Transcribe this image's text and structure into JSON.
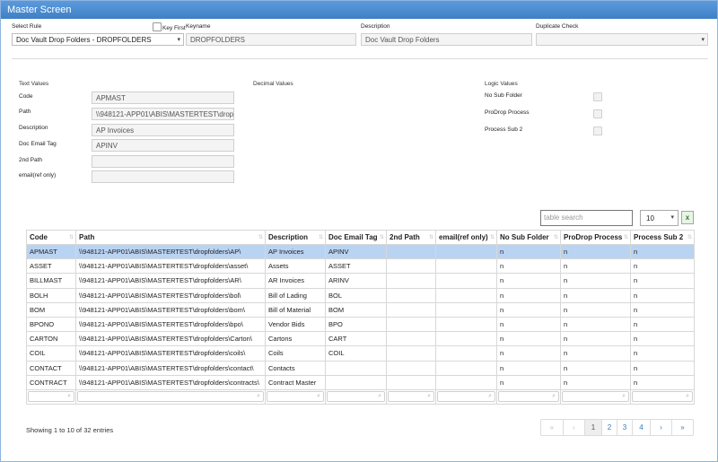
{
  "title": "Master Screen",
  "header": {
    "select_rule_label": "Select Rule",
    "select_rule_value": "Doc Vault Drop Folders - DROPFOLDERS",
    "key_first_label": "Key First",
    "keyname_label": "Keyname",
    "keyname_value": "DROPFOLDERS",
    "description_label": "Description",
    "description_value": "Doc Vault Drop Folders",
    "duplicate_check_label": "Duplicate Check",
    "duplicate_check_value": ""
  },
  "sections": {
    "text_values": "Text Values",
    "decimal_values": "Decimal Values",
    "logic_values": "Logic Values"
  },
  "text_fields": [
    {
      "label": "Code",
      "value": "APMAST"
    },
    {
      "label": "Path",
      "value": "\\\\948121-APP01\\ABIS\\MASTERTEST\\dropfolders\\AP\\"
    },
    {
      "label": "Description",
      "value": "AP Invoices"
    },
    {
      "label": "Doc Email Tag",
      "value": "APINV"
    },
    {
      "label": "2nd Path",
      "value": ""
    },
    {
      "label": "email(ref only)",
      "value": ""
    }
  ],
  "logic_fields": [
    {
      "label": "No Sub Folder",
      "checked": false
    },
    {
      "label": "ProDrop Process",
      "checked": false
    },
    {
      "label": "Process Sub 2",
      "checked": false
    }
  ],
  "table_controls": {
    "search_placeholder": "table search",
    "page_size": "10",
    "excel_icon": "excel-export-icon"
  },
  "table": {
    "columns": [
      "Code",
      "Path",
      "Description",
      "Doc Email Tag",
      "2nd Path",
      "email(ref only)",
      "No Sub Folder",
      "ProDrop Process",
      "Process Sub 2"
    ],
    "rows": [
      [
        "APMAST",
        "\\\\948121-APP01\\ABIS\\MASTERTEST\\dropfolders\\AP\\",
        "AP Invoices",
        "APINV",
        "",
        "",
        "n",
        "n",
        "n"
      ],
      [
        "ASSET",
        "\\\\948121-APP01\\ABIS\\MASTERTEST\\dropfolders\\asset\\",
        "Assets",
        "ASSET",
        "",
        "",
        "n",
        "n",
        "n"
      ],
      [
        "BILLMAST",
        "\\\\948121-APP01\\ABIS\\MASTERTEST\\dropfolders\\AR\\",
        "AR Invoices",
        "ARINV",
        "",
        "",
        "n",
        "n",
        "n"
      ],
      [
        "BOLH",
        "\\\\948121-APP01\\ABIS\\MASTERTEST\\dropfolders\\bol\\",
        "Bill of Lading",
        "BOL",
        "",
        "",
        "n",
        "n",
        "n"
      ],
      [
        "BOM",
        "\\\\948121-APP01\\ABIS\\MASTERTEST\\dropfolders\\bom\\",
        "Bill of Material",
        "BOM",
        "",
        "",
        "n",
        "n",
        "n"
      ],
      [
        "BPONO",
        "\\\\948121-APP01\\ABIS\\MASTERTEST\\dropfolders\\bpo\\",
        "Vendor Bids",
        "BPO",
        "",
        "",
        "n",
        "n",
        "n"
      ],
      [
        "CARTON",
        "\\\\948121-APP01\\ABIS\\MASTERTEST\\dropfolders\\Carton\\",
        "Cartons",
        "CART",
        "",
        "",
        "n",
        "n",
        "n"
      ],
      [
        "COIL",
        "\\\\948121-APP01\\ABIS\\MASTERTEST\\dropfolders\\coils\\",
        "Coils",
        "COIL",
        "",
        "",
        "n",
        "n",
        "n"
      ],
      [
        "CONTACT",
        "\\\\948121-APP01\\ABIS\\MASTERTEST\\dropfolders\\contact\\",
        "Contacts",
        "",
        "",
        "",
        "n",
        "n",
        "n"
      ],
      [
        "CONTRACT",
        "\\\\948121-APP01\\ABIS\\MASTERTEST\\dropfolders\\contracts\\",
        "Contract Master",
        "",
        "",
        "",
        "n",
        "n",
        "n"
      ]
    ],
    "selected_row": 0
  },
  "footer": {
    "info": "Showing 1 to 10 of 32 entries",
    "pager": [
      "«",
      "‹",
      "1",
      "2",
      "3",
      "4",
      "›",
      "»"
    ],
    "current_page": "1"
  },
  "colors": {
    "title_bar": "#4a8bd0",
    "selected_row": "#b9d3f3",
    "link": "#337ab7"
  }
}
